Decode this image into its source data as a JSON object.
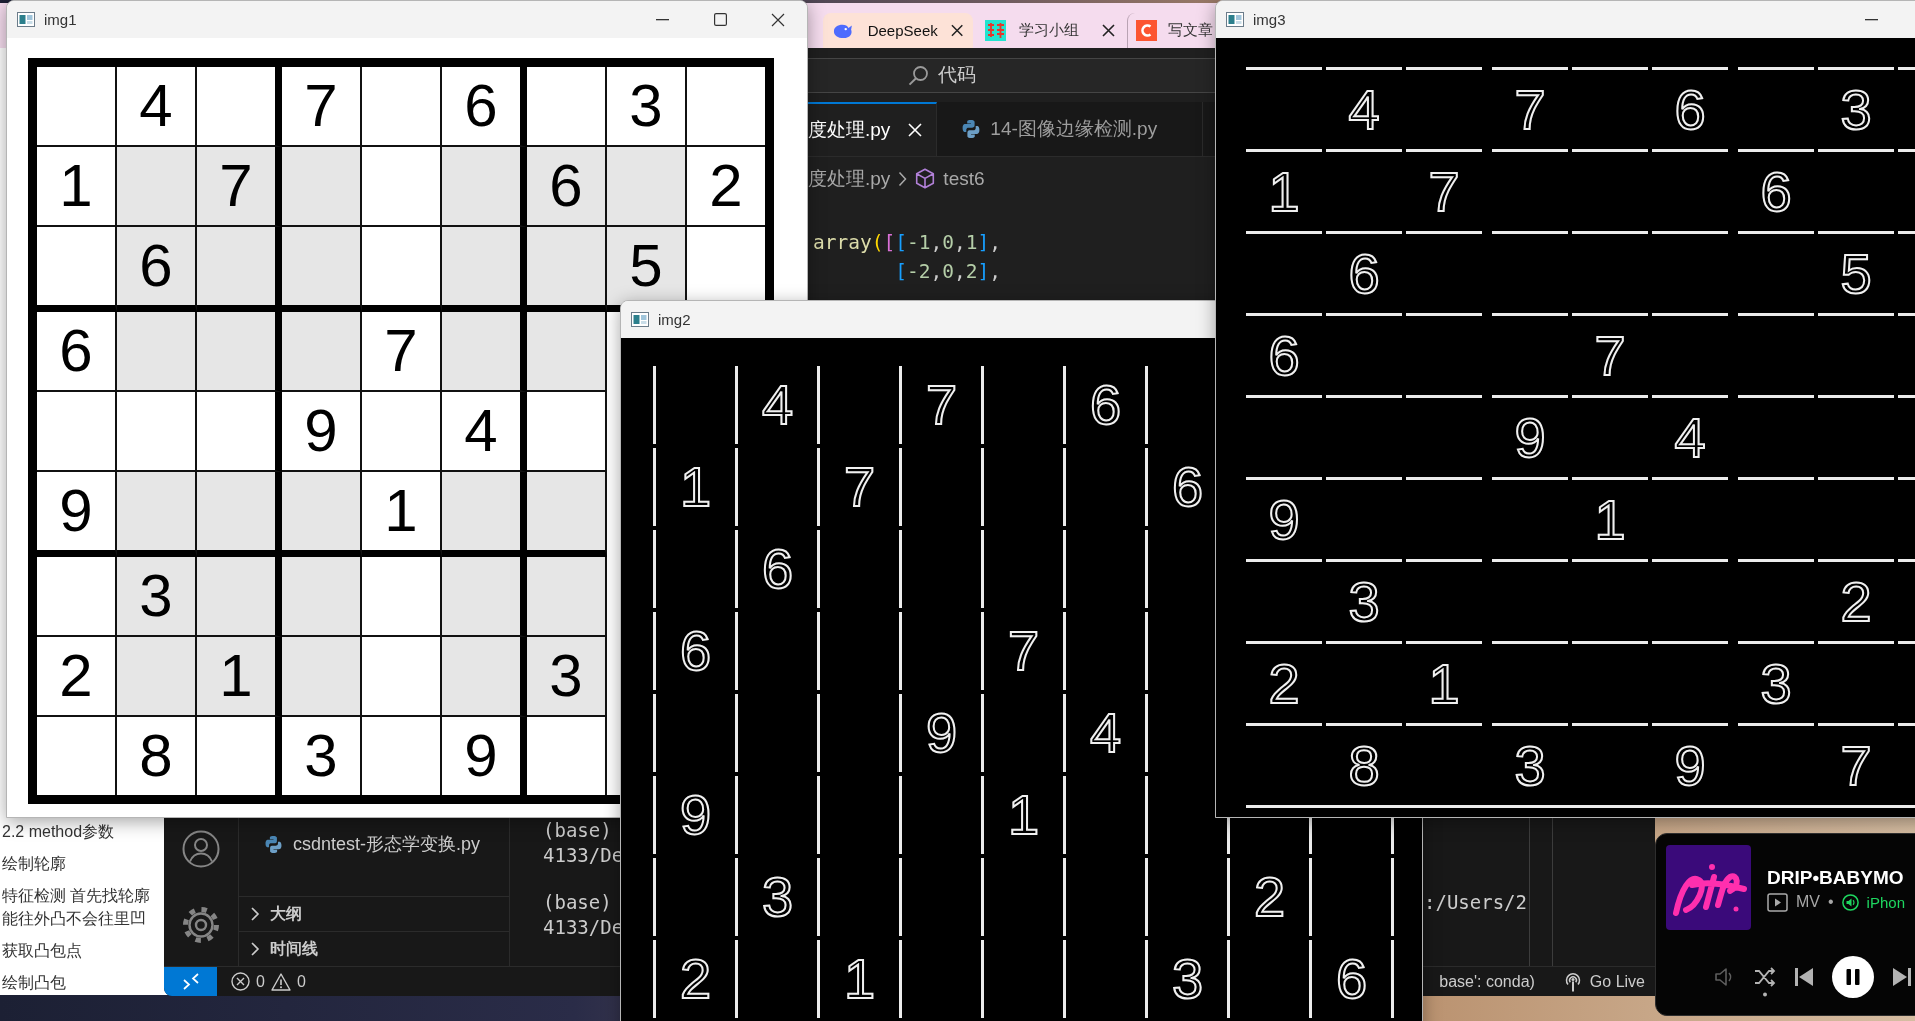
{
  "browser": {
    "tabs": [
      {
        "label": "DeepSeek",
        "selected": true
      },
      {
        "label": "学习小组",
        "selected": false
      },
      {
        "label": "写文章",
        "selected": false
      }
    ],
    "page_blocks": [
      [
        "2.2 method参数"
      ],
      [
        "绘制轮廓"
      ],
      [
        "特征检测 首先找轮廓",
        "能往外凸不会往里凹"
      ],
      [
        "获取凸包点"
      ],
      [
        "绘制凸包"
      ]
    ]
  },
  "code_editor": {
    "command_center": "代码",
    "tabs": [
      {
        "label": "度处理.py",
        "selected": true
      },
      {
        "label": "14-图像边缘检测.py",
        "selected": false
      }
    ],
    "breadcrumb": {
      "file": "度处理.py",
      "symbol": "test6"
    },
    "code_lines": [
      {
        "kind": "statement",
        "tokens": [
          {
            "kind": "function",
            "text": "array"
          },
          {
            "kind": "bracket1",
            "text": "("
          },
          {
            "kind": "bracket2",
            "text": "["
          },
          {
            "kind": "bracket3",
            "text": "["
          },
          {
            "kind": "number",
            "text": "-1"
          },
          {
            "kind": "punct",
            "text": ","
          },
          {
            "kind": "number",
            "text": "0"
          },
          {
            "kind": "punct",
            "text": ","
          },
          {
            "kind": "number",
            "text": "1"
          },
          {
            "kind": "bracket3",
            "text": "]"
          },
          {
            "kind": "punct",
            "text": ","
          }
        ]
      },
      {
        "kind": "continuation",
        "tokens": [
          {
            "kind": "bracket3",
            "text": "["
          },
          {
            "kind": "number",
            "text": "-2"
          },
          {
            "kind": "punct",
            "text": ","
          },
          {
            "kind": "number",
            "text": "0"
          },
          {
            "kind": "punct",
            "text": ","
          },
          {
            "kind": "number",
            "text": "2"
          },
          {
            "kind": "bracket3",
            "text": "]"
          },
          {
            "kind": "punct",
            "text": ","
          }
        ]
      }
    ],
    "explorer": {
      "files": [
        "csdntest-形态学变换.py"
      ],
      "sections": [
        {
          "label": "大纲",
          "expanded": false
        },
        {
          "label": "时间线",
          "expanded": false
        }
      ]
    },
    "terminal": {
      "blocks": [
        [
          {
            "left": "(base)"
          },
          {
            "left": "4133/De"
          }
        ],
        [
          {
            "left": "(base)",
            "right": ":/Users/2"
          },
          {
            "left": "4133/De"
          }
        ]
      ]
    },
    "status_bar": {
      "errors": "0",
      "warnings": "0",
      "interpreter": "base': conda)",
      "live": "Go Live"
    }
  },
  "image_windows": [
    {
      "title": "img1",
      "kind": "original",
      "buttons": {
        "minimize": true,
        "maximize": true,
        "close": true
      },
      "rows": [
        [
          {
            "shaded": false
          },
          {
            "shaded": false,
            "digit": "4"
          },
          {
            "shaded": false
          },
          {
            "shaded": false,
            "digit": "7"
          },
          {
            "shaded": false
          },
          {
            "shaded": false,
            "digit": "6"
          },
          {
            "shaded": false
          },
          {
            "shaded": false,
            "digit": "3"
          },
          {
            "shaded": false
          }
        ],
        [
          {
            "shaded": false,
            "digit": "1"
          },
          {
            "shaded": true
          },
          {
            "shaded": true,
            "digit": "7"
          },
          {
            "shaded": true
          },
          {
            "shaded": false
          },
          {
            "shaded": true
          },
          {
            "shaded": true,
            "digit": "6"
          },
          {
            "shaded": true
          },
          {
            "shaded": false,
            "digit": "2"
          }
        ],
        [
          {
            "shaded": false
          },
          {
            "shaded": true,
            "digit": "6"
          },
          {
            "shaded": true
          },
          {
            "shaded": true
          },
          {
            "shaded": false
          },
          {
            "shaded": true
          },
          {
            "shaded": true
          },
          {
            "shaded": true,
            "digit": "5"
          },
          {
            "shaded": false
          }
        ],
        [
          {
            "shaded": false,
            "digit": "6"
          },
          {
            "shaded": true
          },
          {
            "shaded": true
          },
          {
            "shaded": true
          },
          {
            "shaded": false,
            "digit": "7"
          },
          {
            "shaded": true
          },
          {
            "shaded": true
          }
        ],
        [
          {
            "shaded": false
          },
          {
            "shaded": false
          },
          {
            "shaded": false
          },
          {
            "shaded": false,
            "digit": "9"
          },
          {
            "shaded": false
          },
          {
            "shaded": false,
            "digit": "4"
          },
          {
            "shaded": false
          }
        ],
        [
          {
            "shaded": false,
            "digit": "9"
          },
          {
            "shaded": true
          },
          {
            "shaded": true
          },
          {
            "shaded": true
          },
          {
            "shaded": false,
            "digit": "1"
          },
          {
            "shaded": true
          },
          {
            "shaded": true
          }
        ],
        [
          {
            "shaded": false
          },
          {
            "shaded": true,
            "digit": "3"
          },
          {
            "shaded": true
          },
          {
            "shaded": true
          },
          {
            "shaded": false
          },
          {
            "shaded": true
          },
          {
            "shaded": true
          }
        ],
        [
          {
            "shaded": false,
            "digit": "2"
          },
          {
            "shaded": true
          },
          {
            "shaded": true,
            "digit": "1"
          },
          {
            "shaded": true
          },
          {
            "shaded": false
          },
          {
            "shaded": true
          },
          {
            "shaded": true,
            "digit": "3"
          }
        ],
        [
          {
            "shaded": false
          },
          {
            "shaded": false,
            "digit": "8"
          },
          {
            "shaded": false
          },
          {
            "shaded": false,
            "digit": "3"
          },
          {
            "shaded": false
          },
          {
            "shaded": false,
            "digit": "9"
          },
          {
            "shaded": false
          }
        ]
      ]
    },
    {
      "title": "img2",
      "kind": "vertical_edges",
      "rows": [
        [
          null,
          "4",
          null,
          "7",
          null,
          "6",
          null,
          null,
          null
        ],
        [
          "1",
          null,
          "7",
          null,
          null,
          null,
          "6",
          null,
          null
        ],
        [
          null,
          "6",
          null,
          null,
          null,
          null,
          null,
          null,
          null
        ],
        [
          "6",
          null,
          null,
          null,
          "7",
          null,
          null,
          null,
          null
        ],
        [
          null,
          null,
          null,
          "9",
          null,
          "4",
          null,
          null,
          null
        ],
        [
          "9",
          null,
          null,
          null,
          "1",
          null,
          null,
          null,
          null
        ],
        [
          null,
          "3",
          null,
          null,
          null,
          null,
          null,
          "2",
          null
        ],
        [
          "2",
          null,
          "1",
          null,
          null,
          null,
          "3",
          null,
          "6"
        ]
      ]
    },
    {
      "title": "img3",
      "kind": "horizontal_edges",
      "buttons": {
        "minimize": true
      },
      "rows": [
        [
          null,
          "4",
          null,
          "7",
          null,
          "6",
          null,
          "3",
          null
        ],
        [
          "1",
          null,
          "7",
          null,
          null,
          null,
          "6",
          null,
          null
        ],
        [
          null,
          "6",
          null,
          null,
          null,
          null,
          null,
          "5",
          null
        ],
        [
          "6",
          null,
          null,
          null,
          "7",
          null,
          null,
          null,
          null
        ],
        [
          null,
          null,
          null,
          "9",
          null,
          "4",
          null,
          null,
          null
        ],
        [
          "9",
          null,
          null,
          null,
          "1",
          null,
          null,
          null,
          null
        ],
        [
          null,
          "3",
          null,
          null,
          null,
          null,
          null,
          "2",
          null
        ],
        [
          "2",
          null,
          "1",
          null,
          null,
          null,
          "3",
          null,
          null
        ],
        [
          null,
          "8",
          null,
          "3",
          null,
          "9",
          null,
          "7",
          null
        ]
      ]
    }
  ],
  "media_player": {
    "title": "DRIP•BABYMO",
    "label": "MV",
    "separator": "•",
    "device": "iPhon",
    "shuffle": true,
    "playing": true
  }
}
